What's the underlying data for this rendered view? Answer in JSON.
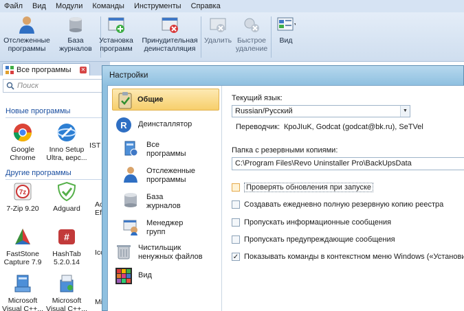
{
  "menu": [
    "Файл",
    "Вид",
    "Модули",
    "Команды",
    "Инструменты",
    "Справка"
  ],
  "toolbar": {
    "tracked_programs": "Отслеженные\nпрограммы",
    "logs_db": "База\nжурналов",
    "install_programs": "Установка\nпрограмм",
    "forced_uninstall": "Принудительная\nдеинсталляция",
    "remove": "Удалить",
    "quick_remove": "Быстрое\nудаление",
    "view": "Вид"
  },
  "tab": {
    "label": "Все программы"
  },
  "search": {
    "placeholder": "Поиск"
  },
  "left": {
    "new_programs": "Новые программы",
    "other_programs": "Другие программы",
    "new_apps": [
      "Google\nChrome",
      "Inno Setup\nUltra, верс...",
      "IST"
    ],
    "other_apps": [
      "7-Zip 9.20",
      "Adguard",
      "Ac\nEfl",
      "FastStone\nCapture 7.9",
      "HashTab\n5.2.0.14",
      "Ico",
      "Microsoft\nVisual C++...",
      "Microsoft\nVisual C++...",
      "Mi"
    ]
  },
  "dialog": {
    "title": "Настройки",
    "nav": {
      "general": "Общие",
      "uninstaller": "Деинсталлятор",
      "all_programs": "Все\nпрограммы",
      "tracked": "Отслеженные\nпрограммы",
      "logs": "База\nжурналов",
      "group_manager": "Менеджер\nгрупп",
      "junk_cleaner": "Чистильщик\nненужных файлов",
      "view": "Вид"
    },
    "current_language_label": "Текущий язык:",
    "language_value": "Russian/Русский",
    "translator_label": "Переводчик:",
    "translator_value": "КроJIuK, Godcat (godcat@bk.ru), SeTVel",
    "backup_folder_label": "Папка с резервными копиями:",
    "backup_folder_value": "C:\\Program Files\\Revo Uninstaller Pro\\BackUpsData",
    "options": [
      {
        "label": "Проверять обновления при запуске",
        "checked": false
      },
      {
        "label": "Создавать ежедневно полную резервную копию реестра",
        "checked": false
      },
      {
        "label": "Пропускать информационные сообщения",
        "checked": false
      },
      {
        "label": "Пропускать предупреждающие сообщения",
        "checked": false
      },
      {
        "label": "Показывать команды в контекстном меню Windows («Установить с...",
        "checked": true
      }
    ]
  }
}
